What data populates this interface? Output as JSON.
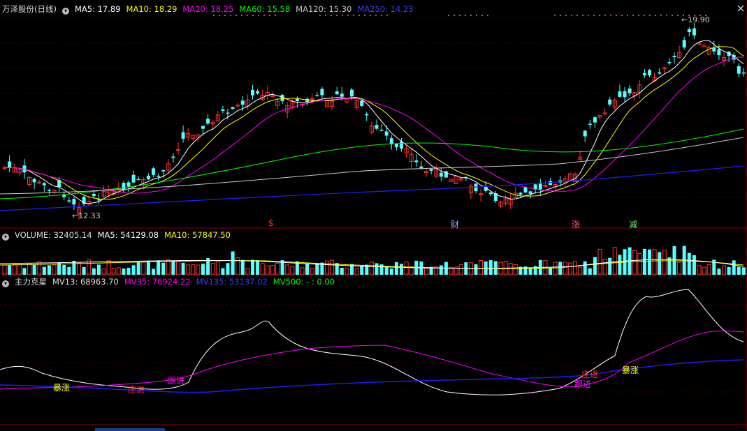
{
  "main": {
    "title": "万泽股份(日线)",
    "ma5": "MA5: 17.89",
    "ma10": "MA10: 18.29",
    "ma20": "MA20: 18.25",
    "ma60": "MA60: 15.58",
    "ma120": "MA120: 15.30",
    "ma250": "MA250: 14.23",
    "high_label": "19.90",
    "low_label": "12.33",
    "markers": [
      "$",
      "财",
      "涨",
      "减"
    ]
  },
  "volume": {
    "label": "VOLUME: 32405.14",
    "ma5": "MA5: 54129.08",
    "ma10": "MA10: 57847.50"
  },
  "indicator": {
    "title": "主力克星",
    "mv13": "MV13: 68963.70",
    "mv35": "MV35: 76924.22",
    "mv135": "MV135: 53137.02",
    "mv500": "MV500: - : 0.00",
    "annotations": [
      "暴涨",
      "庄进",
      "跟进",
      "庄进",
      "跟进",
      "暴涨"
    ]
  },
  "colors": {
    "ma5": "#ffffff",
    "ma10": "#ffff00",
    "ma20": "#ff00ff",
    "ma60": "#00ff00",
    "ma120": "#c8c8c8",
    "ma250": "#1e1eff",
    "up": "#ff3232",
    "down": "#54ffff",
    "indicator_mv13": "#ffffff",
    "indicator_mv35": "#ff00ff",
    "indicator_mv135": "#1e1eff"
  }
}
